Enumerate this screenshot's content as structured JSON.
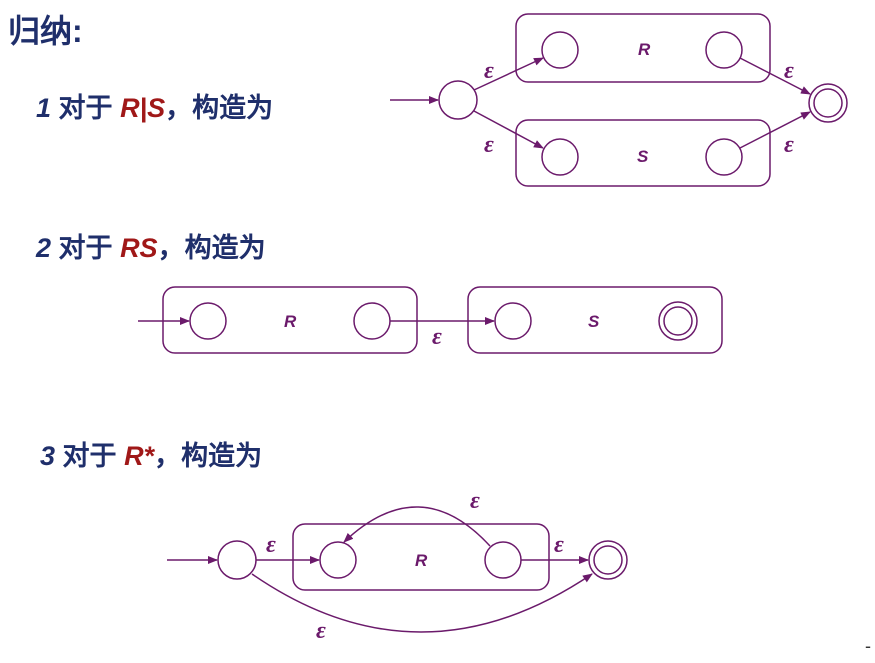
{
  "title": "归纳:",
  "rules": [
    {
      "number": "1",
      "prefix": "对于",
      "expr": "R|S",
      "suffix": "，构造为"
    },
    {
      "number": "2",
      "prefix": "对于",
      "expr": "RS",
      "suffix": "，构造为"
    },
    {
      "number": "3",
      "prefix": "对于",
      "expr": "R*",
      "suffix": "，构造为"
    }
  ],
  "labels": {
    "R": "R",
    "S": "S",
    "epsilon": "ε"
  },
  "colors": {
    "heading": "#1f2f6b",
    "expr": "#a01818",
    "diagram": "#6b1a6b"
  },
  "footer": "-"
}
